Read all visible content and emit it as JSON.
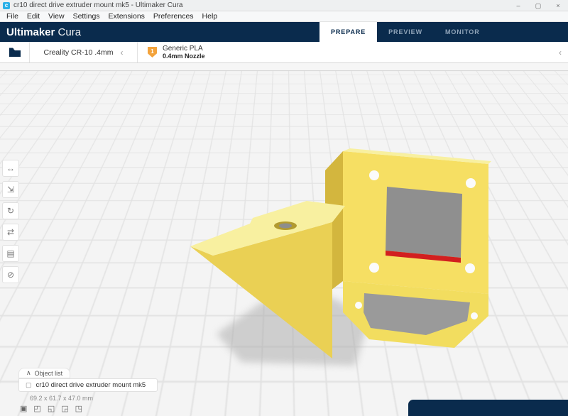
{
  "window": {
    "app_icon": "c",
    "title": "cr10 direct drive extruder mount mk5 - Ultimaker Cura",
    "controls": {
      "minimize": "–",
      "maximize": "▢",
      "close": "×"
    }
  },
  "menu_bar": {
    "items": [
      "File",
      "Edit",
      "View",
      "Settings",
      "Extensions",
      "Preferences",
      "Help"
    ]
  },
  "header": {
    "brand_bold": "Ultimaker",
    "brand_light": "Cura",
    "stages": [
      {
        "label": "PREPARE",
        "active": true
      },
      {
        "label": "PREVIEW",
        "active": false
      },
      {
        "label": "MONITOR",
        "active": false
      }
    ]
  },
  "config_bar": {
    "printer": {
      "name": "Creality CR-10 .4mm",
      "collapse_chevron": "‹"
    },
    "material": {
      "extruder_badge": "1",
      "name": "Generic PLA",
      "nozzle": "0.4mm Nozzle"
    },
    "right_chevron": "‹"
  },
  "left_toolbar": {
    "tools": [
      {
        "name": "move",
        "glyph": "↔"
      },
      {
        "name": "scale",
        "glyph": "⇲"
      },
      {
        "name": "rotate",
        "glyph": "↻"
      },
      {
        "name": "mirror",
        "glyph": "⇄"
      },
      {
        "name": "per-model-settings",
        "glyph": "▤"
      },
      {
        "name": "support-blocker",
        "glyph": "⊘"
      }
    ]
  },
  "object_list": {
    "collapse_caret": "∧",
    "header": "Object list",
    "item_icon": "▢",
    "item_name": "cr10 direct drive extruder mount mk5",
    "dimensions": "69.2 x 61.7 x 47.0 mm"
  },
  "view_presets": {
    "icons": [
      "▣",
      "◰",
      "◱",
      "◲",
      "◳"
    ]
  },
  "colors": {
    "header_bg": "#0a2b4d",
    "stage_active_bg": "#ffffff",
    "model_yellow": "#f6df63",
    "model_yellow_dark": "#d3b63e",
    "model_yellow_light": "#f8f0a0",
    "model_yellow_mid": "#ead054",
    "seam_red": "#d21f1f",
    "extruder_orange": "#f3a33c",
    "shadow_gray": "#a8a8a8"
  }
}
